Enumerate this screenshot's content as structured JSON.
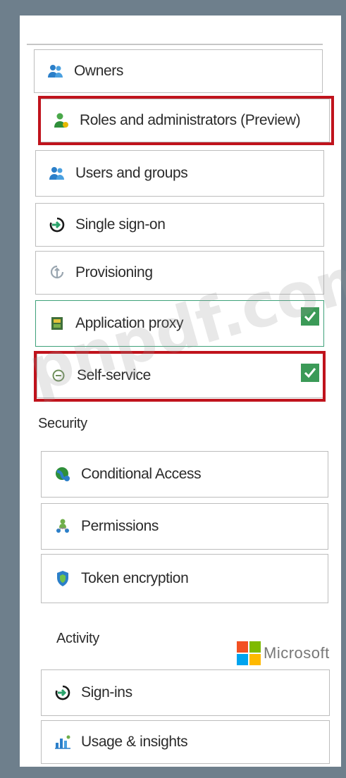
{
  "menu": {
    "owners": "Owners",
    "roles": "Roles and administrators (Preview)",
    "users_groups": "Users and groups",
    "single_sign_on": "Single sign-on",
    "provisioning": "Provisioning",
    "application_proxy": "Application proxy",
    "self_service": "Self-service"
  },
  "security": {
    "heading": "Security",
    "conditional_access": "Conditional Access",
    "permissions": "Permissions",
    "token_encryption": "Token encryption"
  },
  "activity": {
    "heading": "Activity",
    "sign_ins": "Sign-ins",
    "usage_insights": "Usage & insights"
  },
  "watermark": "pnpdf.com",
  "logo": {
    "text": "Microsoft",
    "colors": [
      "#f25022",
      "#7fba00",
      "#00a4ef",
      "#ffb900"
    ]
  },
  "colors": {
    "highlight": "#c0131c",
    "check": "#3b9a57",
    "active_border": "#3fa17a"
  }
}
